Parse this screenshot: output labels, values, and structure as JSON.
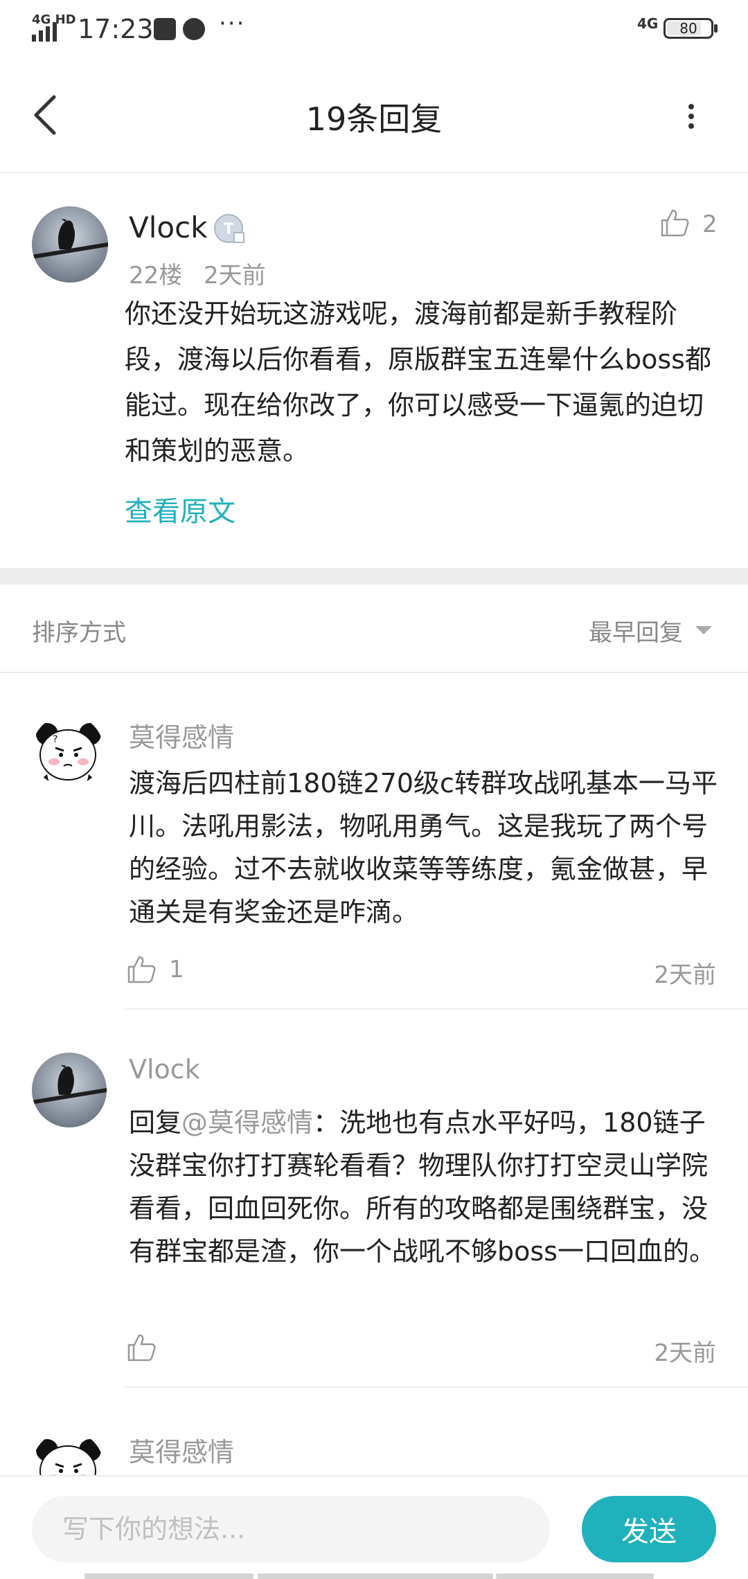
{
  "status_bar": {
    "network": "4G HD",
    "time": "17:23",
    "more": "···",
    "network_right": "4G",
    "battery": "80",
    "battery_level": 0.8
  },
  "header": {
    "title": "19条回复"
  },
  "main_comment": {
    "author": "Vlock",
    "badge_letter": "T",
    "floor": "22楼",
    "time": "2天前",
    "likes": "2",
    "text": "你还没开始玩这游戏呢，渡海前都是新手教程阶段，渡海以后你看看，原版群宝五连晕什么boss都能过。现在给你改了，你可以感受一下逼氪的迫切和策划的恶意。",
    "view_original": "查看原文"
  },
  "sort": {
    "label": "排序方式",
    "value": "最早回复"
  },
  "replies": [
    {
      "author": "莫得感情",
      "text": "渡海后四柱前180链270级c转群攻战吼基本一马平川。法吼用影法，物吼用勇气。这是我玩了两个号的经验。过不去就收收菜等等练度，氪金做甚，早通关是有奖金还是咋滴。",
      "likes": "1",
      "time": "2天前"
    },
    {
      "author": "Vlock",
      "reply_prefix": "回复",
      "reply_to": "@莫得感情",
      "text": "：洗地也有点水平好吗，180链子没群宝你打打赛轮看看？物理队你打打空灵山学院看看，回血回死你。所有的攻略都是围绕群宝，没有群宝都是渣，你一个战吼不够boss一口回血的。",
      "likes": "",
      "time": "2天前"
    },
    {
      "author": "莫得感情"
    }
  ],
  "composer": {
    "placeholder": "写下你的想法...",
    "send_label": "发送"
  },
  "colors": {
    "accent": "#1fb1bc",
    "muted_text": "#999999",
    "divider": "#ececec"
  },
  "icons": {
    "back": "chevron-left-icon",
    "more": "more-vertical-icon",
    "like": "thumbs-up-icon",
    "dropdown": "caret-down-icon"
  }
}
